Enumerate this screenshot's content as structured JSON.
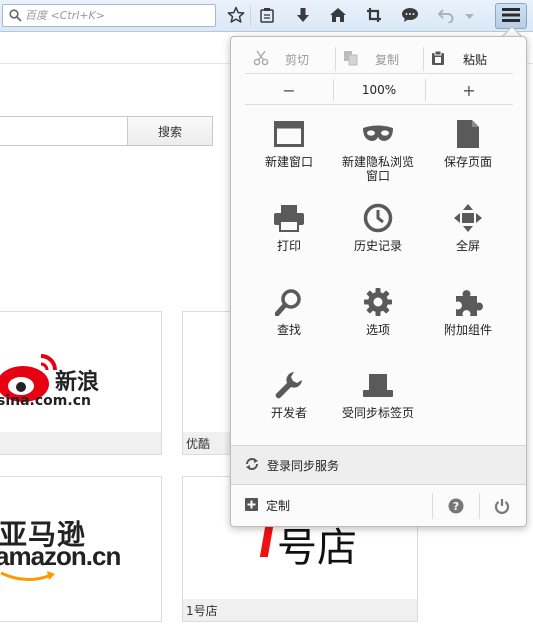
{
  "toolbar": {
    "search_placeholder": "百度 <Ctrl+K>",
    "icons": [
      "search-icon",
      "star-icon",
      "clipboard-icon",
      "download-icon",
      "home-icon",
      "crop-icon",
      "chat-icon",
      "undo-icon",
      "dropdown-icon",
      "hamburger-menu-icon"
    ]
  },
  "page": {
    "search_button": "搜索",
    "tiles": [
      {
        "caption": "",
        "logo_text_zh": "新浪",
        "logo_text_domain": "sina.com.cn"
      },
      {
        "caption": "优酷"
      },
      {
        "caption": "",
        "logo_text_zh": "亚马逊",
        "logo_text_en": "amazon.cn"
      },
      {
        "caption": "1号店",
        "logo_text": "号店"
      }
    ]
  },
  "menu": {
    "edit": {
      "cut": "剪切",
      "copy": "复制",
      "paste": "粘贴"
    },
    "zoom": {
      "minus": "−",
      "value": "100%",
      "plus": "+"
    },
    "items": [
      {
        "label_1": "新建窗口",
        "label_2": "",
        "icon": "new-window-icon"
      },
      {
        "label_1": "新建隐私浏览",
        "label_2": "窗口",
        "icon": "private-mask-icon"
      },
      {
        "label_1": "保存页面",
        "label_2": "",
        "icon": "save-page-icon"
      },
      {
        "label_1": "打印",
        "label_2": "",
        "icon": "print-icon"
      },
      {
        "label_1": "历史记录",
        "label_2": "",
        "icon": "history-clock-icon"
      },
      {
        "label_1": "全屏",
        "label_2": "",
        "icon": "fullscreen-icon"
      },
      {
        "label_1": "查找",
        "label_2": "",
        "icon": "find-icon"
      },
      {
        "label_1": "选项",
        "label_2": "",
        "icon": "options-gear-icon"
      },
      {
        "label_1": "附加组件",
        "label_2": "",
        "icon": "addons-puzzle-icon"
      },
      {
        "label_1": "开发者",
        "label_2": "",
        "icon": "developer-wrench-icon"
      },
      {
        "label_1": "受同步标签页",
        "label_2": "",
        "icon": "synced-tabs-icon"
      }
    ],
    "sync_label": "登录同步服务",
    "customize_label": "定制",
    "colors": {
      "icon_gray": "#5a5a5a",
      "panel_bg": "#fbfbfb",
      "footer_bg": "#eeeeee"
    }
  }
}
